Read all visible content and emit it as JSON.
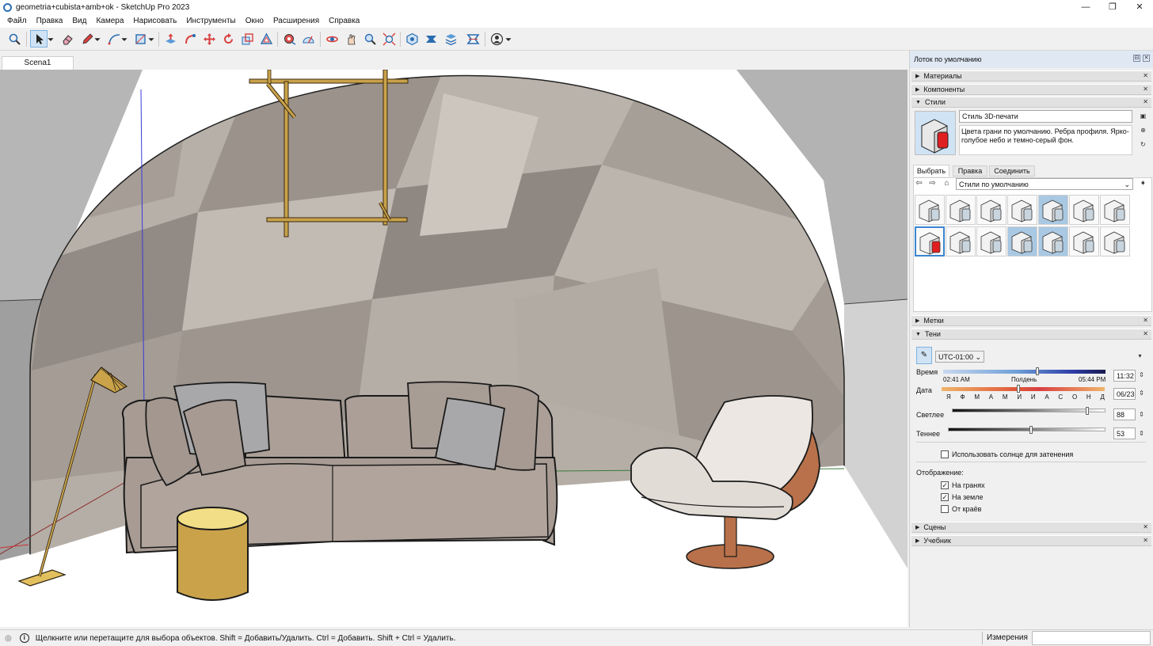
{
  "window": {
    "title": "geometria+cubista+amb+ok - SketchUp Pro 2023",
    "controls": {
      "minimize": "—",
      "maximize": "❐",
      "close": "✕"
    }
  },
  "menu": [
    "Файл",
    "Правка",
    "Вид",
    "Камера",
    "Нарисовать",
    "Инструменты",
    "Окно",
    "Расширения",
    "Справка"
  ],
  "toolbar": {
    "icons": [
      "search-icon",
      "select-arrow-icon",
      "eraser-icon",
      "pencil-icon",
      "arc-icon",
      "shape-icon",
      "push-pull-icon",
      "follow-me-icon",
      "move-icon",
      "rotate-icon",
      "scale-icon",
      "offset-icon",
      "tape-measure-icon",
      "protractor-icon",
      "orbit-icon",
      "pan-icon",
      "zoom-icon",
      "zoom-extents-icon",
      "3d-warehouse-icon",
      "extension-warehouse-icon",
      "layout-icon",
      "style-builder-icon",
      "account-icon"
    ]
  },
  "scene_tab": "Scena1",
  "tray": {
    "title": "Лоток по умолчанию",
    "panels": {
      "materials": "Материалы",
      "components": "Компоненты",
      "styles": "Стили",
      "tags": "Метки",
      "shadows": "Тени",
      "scenes": "Сцены",
      "instructor": "Учебник"
    },
    "styles": {
      "name": "Стиль 3D-печати",
      "description": "Цвета грани по умолчанию. Ребра профиля. Ярко-голубое небо и темно-серый фон.",
      "tabs": [
        "Выбрать",
        "Правка",
        "Соединить"
      ],
      "active_tab": "Выбрать",
      "collection": "Стили по умолчанию",
      "thumb_count": 14,
      "selected_index": 7
    },
    "shadows": {
      "timezone": "UTC-01:00",
      "time_label": "Время",
      "time_marks": [
        "02:41 AM",
        "Полдень",
        "05:44 PM"
      ],
      "time_value": "11:32",
      "time_fraction": 0.58,
      "date_label": "Дата",
      "months": [
        "Я",
        "Ф",
        "М",
        "А",
        "М",
        "И",
        "И",
        "А",
        "С",
        "О",
        "Н",
        "Д"
      ],
      "date_value": "06/23",
      "date_fraction": 0.47,
      "light_label": "Светлее",
      "light_value": "88",
      "light_fraction": 0.88,
      "dark_label": "Теннее",
      "dark_value": "53",
      "dark_fraction": 0.53,
      "use_sun_label": "Использовать солнце для затенения",
      "use_sun_checked": false,
      "display_label": "Отображение:",
      "on_faces_label": "На гранях",
      "on_faces_checked": true,
      "on_ground_label": "На земле",
      "on_ground_checked": true,
      "from_edges_label": "От краёв",
      "from_edges_checked": false
    }
  },
  "status": {
    "hint": "Щелкните или перетащите для выбора объектов. Shift = Добавить/Удалить. Ctrl = Добавить. Shift + Ctrl = Удалить.",
    "measurements_label": "Измерения",
    "measurements_value": ""
  },
  "colors": {
    "wall": "#9d958d",
    "sofa": "#a79b93",
    "pillow": "#a8a8aa",
    "stool": "#e2c05d",
    "brass": "#c9a24a",
    "chair_seat": "#ece7e2",
    "chair_shell": "#b8714a"
  }
}
